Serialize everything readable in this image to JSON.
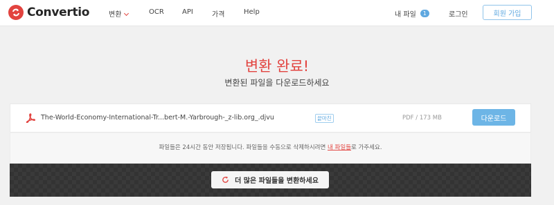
{
  "header": {
    "brand": "Convertio",
    "nav": [
      {
        "label": "변환",
        "has_dropdown": true
      },
      {
        "label": "OCR"
      },
      {
        "label": "API"
      },
      {
        "label": "가격"
      },
      {
        "label": "Help"
      }
    ],
    "my_files_label": "내 파일",
    "my_files_count": "1",
    "login_label": "로그인",
    "signup_label": "회원 가입"
  },
  "main": {
    "title": "변환 완료!",
    "subtitle": "변환된 파일을 다운로드하세요"
  },
  "file": {
    "icon": "pdf-icon",
    "name": "The-World-Economy-International-Tr...bert-M.-Yarbrough-_z-lib.org_.djvu",
    "tag": "끝마친",
    "info": "PDF / 173 MB",
    "download_label": "다운로드"
  },
  "notice": {
    "text_before": "파일들은 24시간 동안 저장됩니다. 파일들을 수동으로 삭제하시려면 ",
    "link_text": "내 파일들",
    "text_after": "로 가주세요."
  },
  "convert_more": {
    "label": "더 많은 파일들을 변환하세요",
    "icon": "refresh-icon"
  },
  "colors": {
    "brand_red": "#e2433f",
    "accent_blue": "#6db5e6"
  }
}
